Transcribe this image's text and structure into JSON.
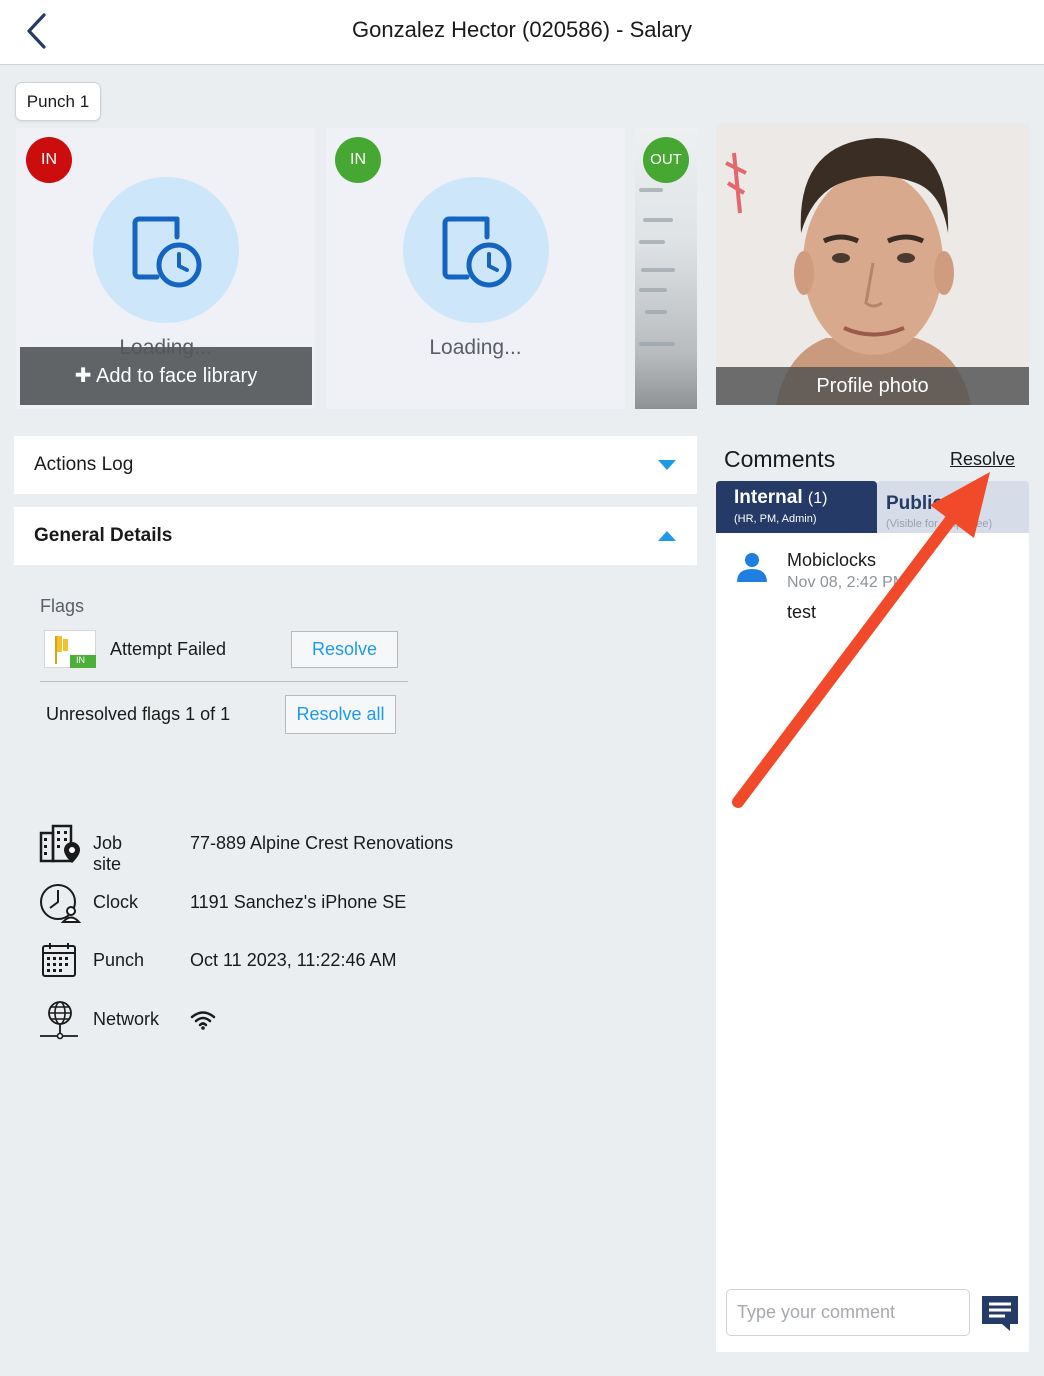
{
  "header": {
    "title": "Gonzalez Hector (020586) - Salary",
    "back_icon": "chevron-left-icon"
  },
  "punch_chip": "Punch 1",
  "punch_cards": [
    {
      "badge": "IN",
      "badge_color": "#cc0d0d",
      "loading": "Loading...",
      "overlay": "Add to face library"
    },
    {
      "badge": "IN",
      "badge_color": "#46a832",
      "loading": "Loading..."
    },
    {
      "badge": "OUT",
      "badge_color": "#46a832"
    }
  ],
  "profile": {
    "caption": "Profile photo"
  },
  "sections": {
    "actions_log": "Actions Log",
    "general_details": "General Details"
  },
  "flags": {
    "title": "Flags",
    "flag_badge": "IN",
    "items": [
      {
        "label": "Attempt Failed",
        "action": "Resolve"
      }
    ],
    "unresolved": "Unresolved flags 1 of 1",
    "resolve_all": "Resolve all"
  },
  "details": [
    {
      "icon": "building-location-icon",
      "label": "Job site",
      "value": "77-889 Alpine Crest Renovations"
    },
    {
      "icon": "clock-user-icon",
      "label": "Clock",
      "value": "1191 Sanchez's iPhone SE"
    },
    {
      "icon": "calendar-icon",
      "label": "Punch",
      "value": "Oct 11 2023, 11:22:46 AM"
    },
    {
      "icon": "globe-network-icon",
      "label": "Network",
      "value": "",
      "value_icon": "wifi-icon"
    }
  ],
  "comments": {
    "title": "Comments",
    "resolve_link": "Resolve",
    "tabs": [
      {
        "label": "Internal",
        "count": "(1)",
        "sub": "(HR, PM, Admin)",
        "active": true
      },
      {
        "label": "Public",
        "sub": "(Visible for employee)",
        "active": false
      }
    ],
    "items": [
      {
        "author": "Mobiclocks",
        "date": "Nov 08, 2:42 PM",
        "text": "test"
      }
    ],
    "input_placeholder": "Type your comment"
  },
  "colors": {
    "accent": "#1e9be6",
    "navy": "#253a66",
    "annotation_arrow": "#f04a2a"
  }
}
